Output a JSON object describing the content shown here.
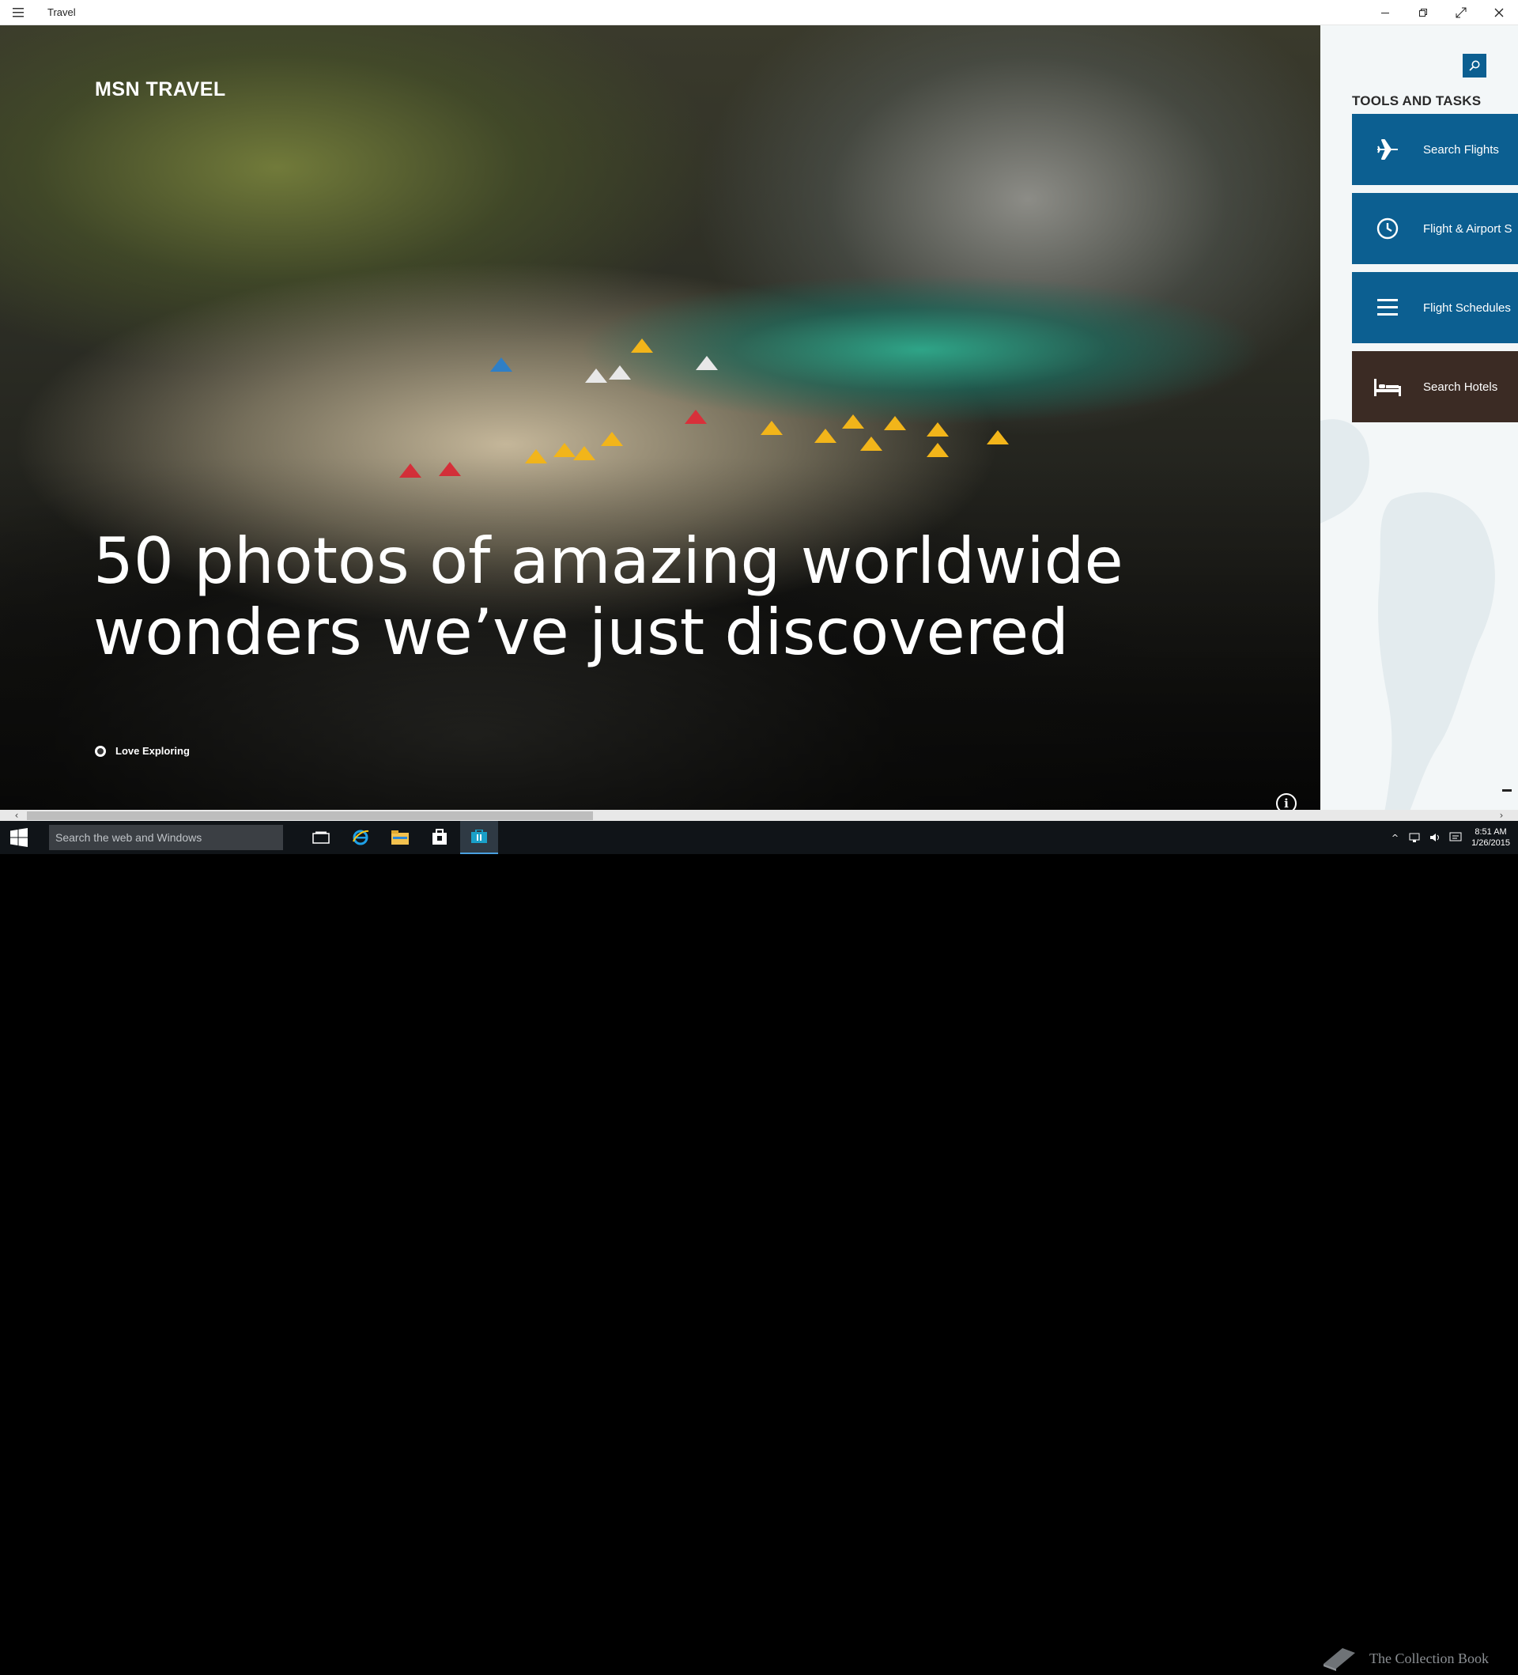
{
  "window": {
    "title": "Travel"
  },
  "hero": {
    "brand": "MSN TRAVEL",
    "headline": "50 photos of amazing worldwide wonders we’ve just discovered",
    "source": "Love Exploring"
  },
  "sidebar": {
    "heading": "TOOLS AND TASKS",
    "tiles": [
      {
        "label": "Search Flights",
        "icon": "airplane-icon",
        "color": "#0c5f91"
      },
      {
        "label": "Flight & Airport S",
        "icon": "clock-icon",
        "color": "#0c5f91"
      },
      {
        "label": "Flight Schedules",
        "icon": "list-icon",
        "color": "#0c5f91"
      },
      {
        "label": "Search Hotels",
        "icon": "bed-icon",
        "color": "#3b2b24"
      }
    ]
  },
  "taskbar": {
    "search_placeholder": "Search the web and Windows",
    "time": "8:51 AM",
    "date": "1/26/2015",
    "watermark": "The Collection Book"
  }
}
